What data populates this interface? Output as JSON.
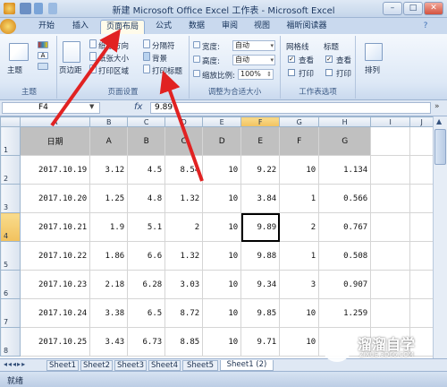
{
  "window": {
    "title": "新建 Microsoft Office Excel 工作表 - Microsoft Excel",
    "min": "–",
    "max": "□",
    "close": "✕"
  },
  "tabs": [
    "开始",
    "插入",
    "页面布局",
    "公式",
    "数据",
    "审阅",
    "视图",
    "福昕阅读器"
  ],
  "ribbon": {
    "groups": {
      "theme": "主题",
      "page_setup": "页面设置",
      "scale": "调整为合适大小",
      "sheet_options": "工作表选项",
      "arrange": "排列"
    },
    "theme_label": "主题",
    "margins_label": "页边距",
    "orientation": "纸张方向",
    "size": "纸张大小",
    "print_area": "打印区域",
    "breaks": "分隔符",
    "background": "背景",
    "print_titles": "打印标题",
    "width_label": "宽度:",
    "height_label": "高度:",
    "scale_label": "缩放比例:",
    "width_value": "自动",
    "height_value": "自动",
    "scale_value": "100%",
    "gridlines": "网格线",
    "headings": "标题",
    "view": "查看",
    "print": "打印",
    "arrange_label": "排列"
  },
  "formula_bar": {
    "name_box": "F4",
    "fx": "fx",
    "value": "9.89"
  },
  "columns": [
    "A",
    "B",
    "C",
    "D",
    "E",
    "F",
    "G",
    "H",
    "I",
    "J"
  ],
  "sheet": {
    "header": [
      "日期",
      "A",
      "B",
      "C",
      "D",
      "E",
      "F",
      "G"
    ],
    "rows": [
      [
        "2017.10.19",
        "3.12",
        "4.5",
        "8.54",
        "10",
        "9.22",
        "10",
        "1.134"
      ],
      [
        "2017.10.20",
        "1.25",
        "4.8",
        "1.32",
        "10",
        "3.84",
        "1",
        "0.566"
      ],
      [
        "2017.10.21",
        "1.9",
        "5.1",
        "2",
        "10",
        "9.89",
        "2",
        "0.767"
      ],
      [
        "2017.10.22",
        "1.86",
        "6.6",
        "1.32",
        "10",
        "9.88",
        "1",
        "0.508"
      ],
      [
        "2017.10.23",
        "2.18",
        "6.28",
        "3.03",
        "10",
        "9.34",
        "3",
        "0.907"
      ],
      [
        "2017.10.24",
        "3.38",
        "6.5",
        "8.72",
        "10",
        "9.85",
        "10",
        "1.259"
      ],
      [
        "2017.10.25",
        "3.43",
        "6.73",
        "8.85",
        "10",
        "9.71",
        "10",
        ""
      ]
    ],
    "row_numbers": [
      "1",
      "2",
      "3",
      "4",
      "5",
      "6",
      "7",
      "8"
    ]
  },
  "sheet_tabs": [
    "Sheet1",
    "Sheet2",
    "Sheet3",
    "Sheet4",
    "Sheet5",
    "Sheet1 (2)"
  ],
  "status": "就绪",
  "watermark": {
    "title": "溜溜自学",
    "sub": "ZIXUE.3D66.COM"
  }
}
